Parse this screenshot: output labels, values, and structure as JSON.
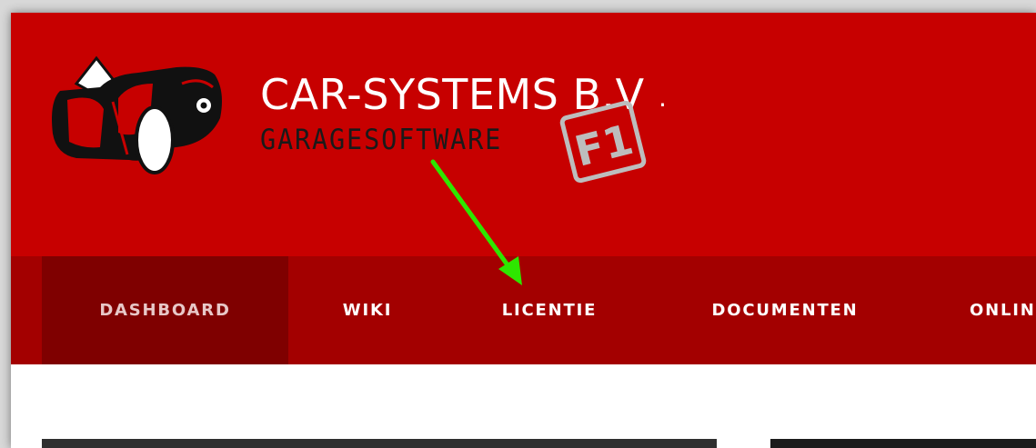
{
  "header": {
    "brand_name": "CAR-SYSTEMS B.V",
    "brand_dot": ".",
    "brand_sub": "GARAGESOFTWARE",
    "badge_text": "F1",
    "background_color": "#c70000"
  },
  "nav": {
    "background_color": "#a30000",
    "active_color": "#7f0000",
    "items": [
      {
        "label": "DASHBOARD",
        "active": true
      },
      {
        "label": "WIKI",
        "active": false
      },
      {
        "label": "LICENTIE",
        "active": false
      },
      {
        "label": "DOCUMENTEN",
        "active": false
      },
      {
        "label": "ONLIN",
        "active": false
      }
    ]
  },
  "annotation": {
    "arrow_color": "#2ee600",
    "icon": "arrow-icon"
  },
  "content": {
    "cards": [
      "image-card-left",
      "image-card-right"
    ]
  }
}
